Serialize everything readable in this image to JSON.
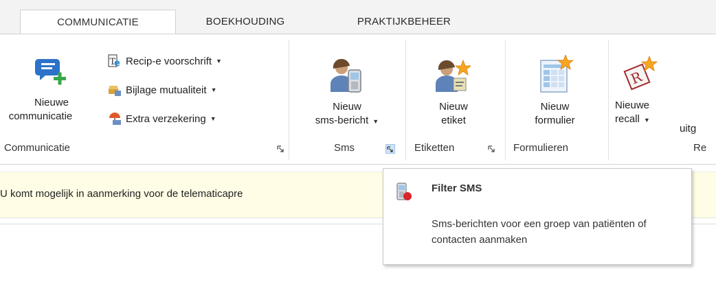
{
  "tabs": [
    {
      "label": "COMMUNICATIE",
      "active": true
    },
    {
      "label": "BOEKHOUDING",
      "active": false
    },
    {
      "label": "PRAKTIJKBEHEER",
      "active": false
    }
  ],
  "ribbon": {
    "communicatie": {
      "group_label": "Communicatie",
      "new_comm_line1": "Nieuwe",
      "new_comm_line2": "communicatie",
      "recipe": "Recip-e voorschrift",
      "bijlage": "Bijlage mutualiteit",
      "extra": "Extra verzekering"
    },
    "sms": {
      "group_label": "Sms",
      "line1": "Nieuw",
      "line2": "sms-bericht"
    },
    "etiketten": {
      "group_label": "Etiketten",
      "line1": "Nieuw",
      "line2": "etiket"
    },
    "formulieren": {
      "group_label": "Formulieren",
      "line1": "Nieuw",
      "line2": "formulier"
    },
    "recall": {
      "group_label": "Re",
      "line1": "Nieuwe",
      "line2": "recall",
      "next_partial": "uitg"
    }
  },
  "infobar": {
    "text": "U komt mogelijk in aanmerking voor de telematicapre"
  },
  "tooltip": {
    "title": "Filter SMS",
    "description": "Sms-berichten voor een groep van patiënten of contacten aanmaken"
  },
  "colors": {
    "tab_strip": "#f3f3f3",
    "infobar_bg": "#fffde5",
    "launcher_active": "#cfe3f7",
    "icon_blue": "#2b73c8",
    "icon_green": "#3aa64a"
  }
}
